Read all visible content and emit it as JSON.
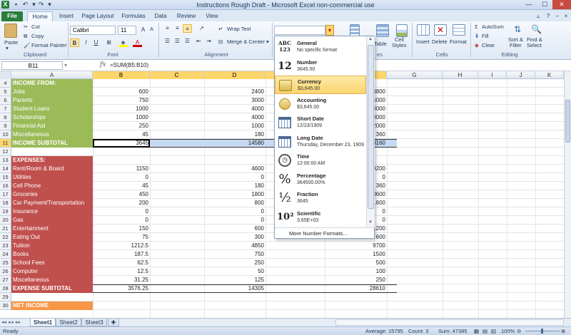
{
  "window": {
    "title": "Instructions Rough Draft - Microsoft Excel non-commercial use",
    "controls": [
      "—",
      "☐",
      "✕"
    ]
  },
  "tabs": [
    "File",
    "Home",
    "Insert",
    "Page Layout",
    "Formulas",
    "Data",
    "Review",
    "View"
  ],
  "ribbon": {
    "paste": "Paste",
    "cut": "Cut",
    "copy": "Copy",
    "format_painter": "Format Painter",
    "clipboard": "Clipboard",
    "font_name": "Calibri",
    "font_size": "11",
    "bold": "B",
    "italic": "I",
    "underline": "U",
    "font_group": "Font",
    "wrap_text": "Wrap Text",
    "merge_center": "Merge & Center",
    "alignment": "Alignment",
    "number_format_value": "",
    "format_as_table": "Format",
    "format_as_table2": "Table",
    "cell_styles": "Cell",
    "cell_styles2": "Styles",
    "styles_group_partial": "es",
    "insert": "Insert",
    "delete": "Delete",
    "format": "Format",
    "cells_group": "Cells",
    "autosum": "AutoSum",
    "fill": "Fill",
    "clear": "Clear",
    "sort_filter": "Sort &",
    "sort_filter2": "Filter",
    "find_select": "Find &",
    "find_select2": "Select",
    "editing_group": "Editing"
  },
  "formula_bar": {
    "name_box": "B11",
    "fx": "fx",
    "formula": "=SUM(B5:B10)"
  },
  "columns": [
    "A",
    "B",
    "C",
    "D",
    "E",
    "F",
    "G",
    "H",
    "I",
    "J",
    "K"
  ],
  "rows": [
    {
      "n": "5",
      "a": "Jobs",
      "b": "600",
      "d": "2400",
      "f": "4800",
      "type": "income"
    },
    {
      "n": "6",
      "a": "Parents",
      "b": "750",
      "d": "3000",
      "f": "6000",
      "type": "income"
    },
    {
      "n": "7",
      "a": "Student Loans",
      "b": "1000",
      "d": "4000",
      "f": "8000",
      "type": "income"
    },
    {
      "n": "8",
      "a": "Scholarships",
      "b": "1000",
      "d": "4000",
      "f": "8000",
      "type": "income"
    },
    {
      "n": "9",
      "a": "Financial Aid",
      "b": "250",
      "d": "1000",
      "f": "2000",
      "type": "income"
    },
    {
      "n": "10",
      "a": "Miscellaneous",
      "b": "45",
      "d": "180",
      "f": "360",
      "type": "income"
    },
    {
      "n": "11",
      "a": "INCOME SUBTOTAL",
      "b": "3645",
      "d": "14580",
      "f": "29160",
      "type": "income-sub"
    },
    {
      "n": "12",
      "a": "",
      "b": "",
      "d": "",
      "f": "",
      "type": "blank"
    },
    {
      "n": "13",
      "a": "EXPENSES:",
      "b": "",
      "d": "",
      "f": "",
      "type": "expense-head"
    },
    {
      "n": "14",
      "a": "Rent/Room & Board",
      "b": "1150",
      "d": "4600",
      "f": "9200",
      "type": "expense"
    },
    {
      "n": "15",
      "a": "Utilities",
      "b": "0",
      "d": "0",
      "f": "0",
      "type": "expense"
    },
    {
      "n": "16",
      "a": "Cell Phone",
      "b": "45",
      "d": "180",
      "f": "360",
      "type": "expense"
    },
    {
      "n": "17",
      "a": "Groceries",
      "b": "450",
      "d": "1800",
      "f": "3600",
      "type": "expense"
    },
    {
      "n": "18",
      "a": "Car Payment/Transportation",
      "b": "200",
      "d": "800",
      "f": "1600",
      "type": "expense"
    },
    {
      "n": "19",
      "a": "Insurance",
      "b": "0",
      "d": "0",
      "f": "0",
      "type": "expense"
    },
    {
      "n": "20",
      "a": "Gas",
      "b": "0",
      "d": "0",
      "f": "0",
      "type": "expense"
    },
    {
      "n": "21",
      "a": "Entertainment",
      "b": "150",
      "d": "600",
      "f": "1200",
      "type": "expense"
    },
    {
      "n": "22",
      "a": "Eating Out",
      "b": "75",
      "d": "300",
      "f": "600",
      "type": "expense"
    },
    {
      "n": "23",
      "a": "Tuition",
      "b": "1212.5",
      "d": "4850",
      "f": "9700",
      "type": "expense"
    },
    {
      "n": "24",
      "a": "Books",
      "b": "187.5",
      "d": "750",
      "f": "1500",
      "type": "expense"
    },
    {
      "n": "25",
      "a": "School Fees",
      "b": "62.5",
      "d": "250",
      "f": "500",
      "type": "expense"
    },
    {
      "n": "26",
      "a": "Computer",
      "b": "12.5",
      "d": "50",
      "f": "100",
      "type": "expense"
    },
    {
      "n": "27",
      "a": "Miscellaneous",
      "b": "31.25",
      "d": "125",
      "f": "250",
      "type": "expense"
    },
    {
      "n": "28",
      "a": "EXPENSE SUBTOTAL",
      "b": "3576.25",
      "d": "14305",
      "f": "28610",
      "type": "expense-sub"
    },
    {
      "n": "29",
      "a": "",
      "b": "",
      "d": "",
      "f": "",
      "type": "blank"
    },
    {
      "n": "30",
      "a": "NET INCOME",
      "b": "",
      "d": "",
      "f": "",
      "type": "net"
    }
  ],
  "row4_label": "INCOME FROM:",
  "number_formats": [
    {
      "name": "General",
      "sub": "No specific format",
      "icon": "ABC\n123"
    },
    {
      "name": "Number",
      "sub": "3645.00",
      "icon": "12"
    },
    {
      "name": "Currency",
      "sub": "$3,645.00",
      "icon": "currency-icon"
    },
    {
      "name": "Accounting",
      "sub": " $3,645.00",
      "icon": "accounting-icon"
    },
    {
      "name": "Short Date",
      "sub": "12/23/1909",
      "icon": "calendar-icon"
    },
    {
      "name": "Long Date",
      "sub": "Thursday, December 23, 1909",
      "icon": "calendar-icon"
    },
    {
      "name": "Time",
      "sub": "12:00:00 AM",
      "icon": "clock-icon"
    },
    {
      "name": "Percentage",
      "sub": "364500.00%",
      "icon": "%"
    },
    {
      "name": "Fraction",
      "sub": "3645",
      "icon": "½"
    },
    {
      "name": "Scientific",
      "sub": "3.65E+03",
      "icon": "10²"
    }
  ],
  "more_formats": "More Number Formats...",
  "sheets": [
    "Sheet1",
    "Sheet2",
    "Sheet3"
  ],
  "status": {
    "ready": "Ready",
    "average": "Average: 15795",
    "count": "Count: 3",
    "sum": "Sum: 47385",
    "zoom": "100%"
  },
  "colors": {
    "income": "#9bbb59",
    "expense": "#c0504d",
    "net": "#f79646",
    "selection": "#c6daf3",
    "highlight": "#fbd570"
  }
}
